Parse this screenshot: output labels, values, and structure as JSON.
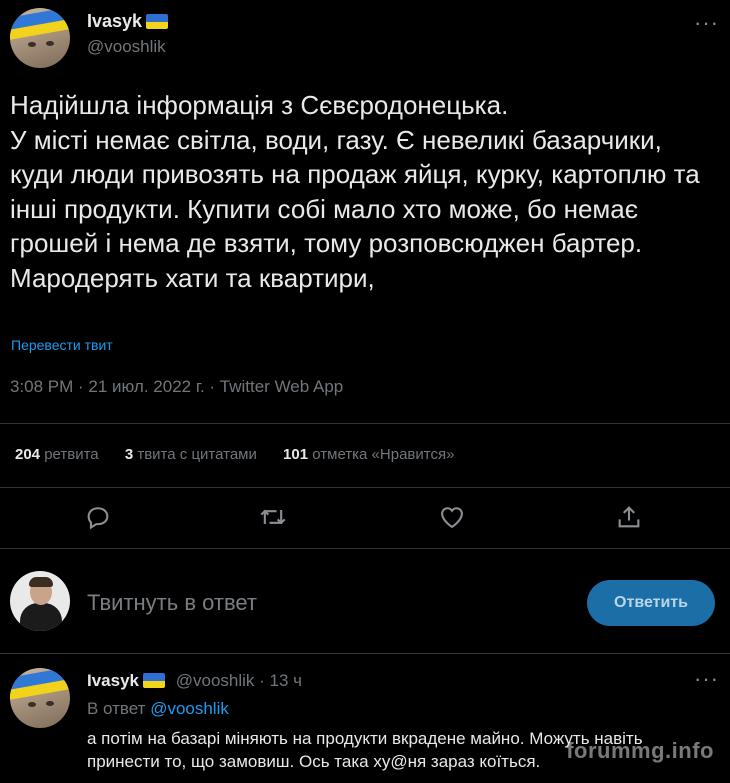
{
  "tweet": {
    "author_name": "Ivasyk",
    "author_handle": "@vooshlik",
    "text": "Надійшла інформація з Сєвєродонецька.\nУ місті немає світла, води, газу. Є невеликі базарчики, куди люди привозять на продаж яйця, курку, картоплю та інші продукти. Купити собі мало хто може, бо немає грошей і нема де взяти, тому розповсюджен бартер. Мародерять хати та квартири,",
    "translate_link": "Перевести твит",
    "timestamp": "3:08 PM · 21 июл. 2022 г. · Twitter Web App",
    "more_icon_label": "···"
  },
  "stats": {
    "retweets_count": "204",
    "retweets_label": "ретвита",
    "quotes_count": "3",
    "quotes_label": "твита с цитатами",
    "likes_count": "101",
    "likes_label": "отметка «Нравится»"
  },
  "actions": {
    "icons": [
      "reply-icon",
      "retweet-icon",
      "like-icon",
      "share-icon"
    ]
  },
  "compose": {
    "placeholder": "Твитнуть в ответ",
    "button_label": "Ответить"
  },
  "reply": {
    "author_name": "Ivasyk",
    "author_handle": "@vooshlik",
    "time": "· 13 ч",
    "reply_to_prefix": "В ответ",
    "reply_to_handle": "@vooshlik",
    "text": "а потім на базарі міняють на продукти вкрадене майно. Можуть навіть принести то, що замовиш. Ось така ху@ня зараз коїться."
  },
  "watermark": "forummg.info",
  "colors": {
    "background": "#000000",
    "accent": "#1d9bf0",
    "muted": "#71767b",
    "button": "#1b6ea6"
  }
}
